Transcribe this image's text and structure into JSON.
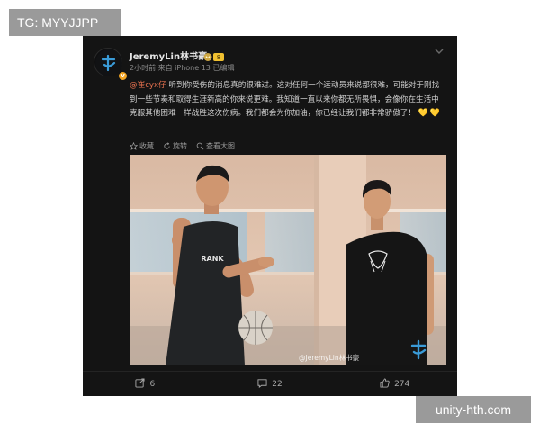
{
  "overlay": {
    "tag_top": "TG: MYYJJPP",
    "tag_bottom": "unity-hth.com"
  },
  "post": {
    "username": "JeremyLin林书豪",
    "meta": "2小时前 来自 iPhone 13 已编辑",
    "mention": "@崔cyx仔",
    "body": " 听到你受伤的消息真的很难过。这对任何一个运动员来说都很难，可能对于刚找到一些节奏和取得生涯新高的你来说更难。我知道一直以来你都无所畏惧，会像你在生活中克服其他困难一样战胜这次伤病。我们都会为你加油，你已经让我们都非常骄傲了！",
    "hearts": "💛💛",
    "actions": {
      "favorite": "收藏",
      "rotate": "旋转",
      "view_large": "查看大图"
    },
    "image_watermark": "@JeremyLin林书豪",
    "footer": {
      "reposts": "6",
      "comments": "22",
      "likes": "274"
    }
  },
  "colors": {
    "card_bg": "#141414",
    "mention": "#eb7350",
    "verified_badge": "#f5a623",
    "tag_bg": "#9a9a9a"
  },
  "icons": [
    "chevron-down-icon",
    "verified-icon",
    "crown-badge-icon",
    "star-icon",
    "rotate-icon",
    "magnify-icon",
    "repost-icon",
    "comment-icon",
    "like-icon"
  ]
}
